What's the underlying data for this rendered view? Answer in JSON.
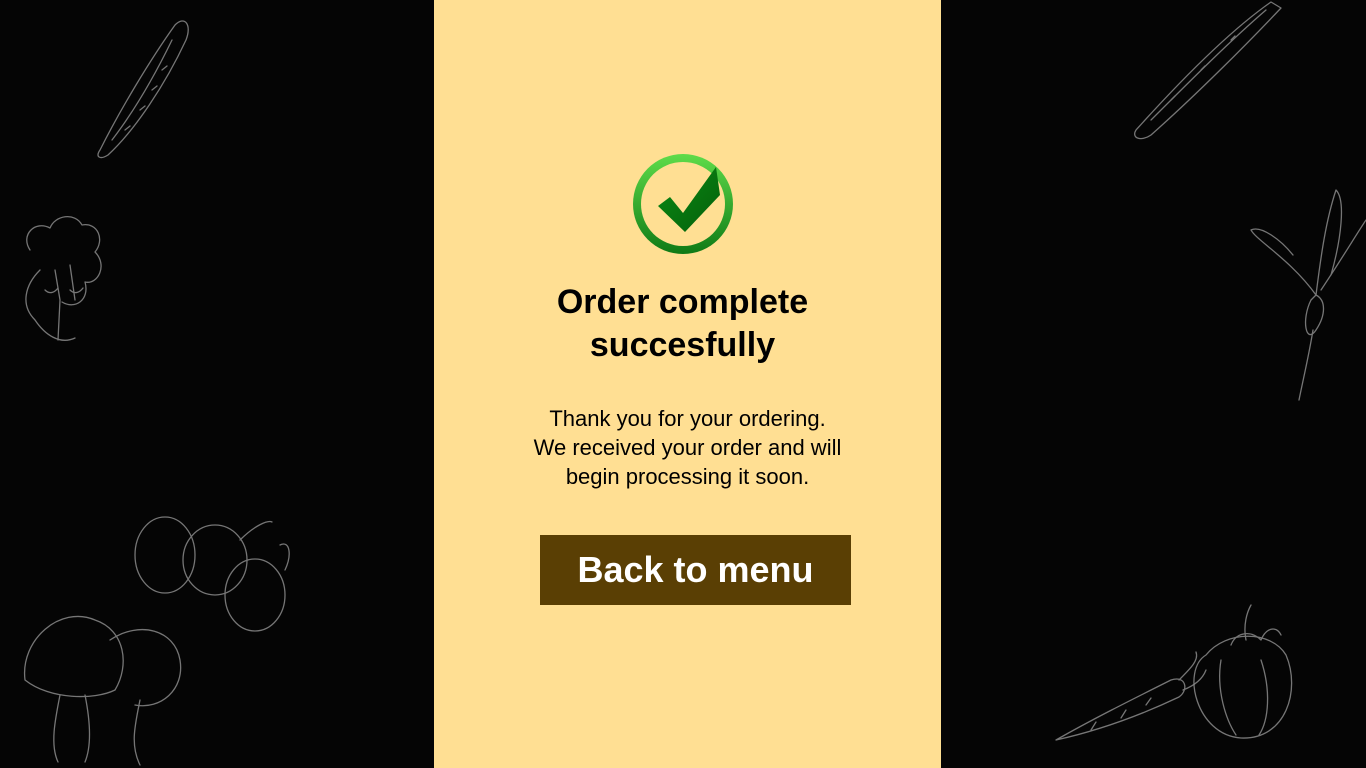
{
  "confirmation": {
    "icon": "check-circle-icon",
    "title_line1": "Order complete",
    "title_line2": "succesfully",
    "message_line1": "Thank you for your ordering.",
    "message_line2": "We received your order and will",
    "message_line3": "begin processing it soon.",
    "back_button_label": "Back to menu"
  },
  "colors": {
    "panel_background": "#ffdf93",
    "page_background": "#050505",
    "button_background": "#5a3f04",
    "button_text": "#ffffff",
    "check_green": "#1e9b1e"
  },
  "background": {
    "left_illustrations": [
      "cucumber-icon",
      "broccoli-icon",
      "grapes-icon",
      "mushroom-icon"
    ],
    "right_illustrations": [
      "cucumber-icon",
      "radish-icon",
      "tomato-icon",
      "carrot-icon"
    ]
  }
}
